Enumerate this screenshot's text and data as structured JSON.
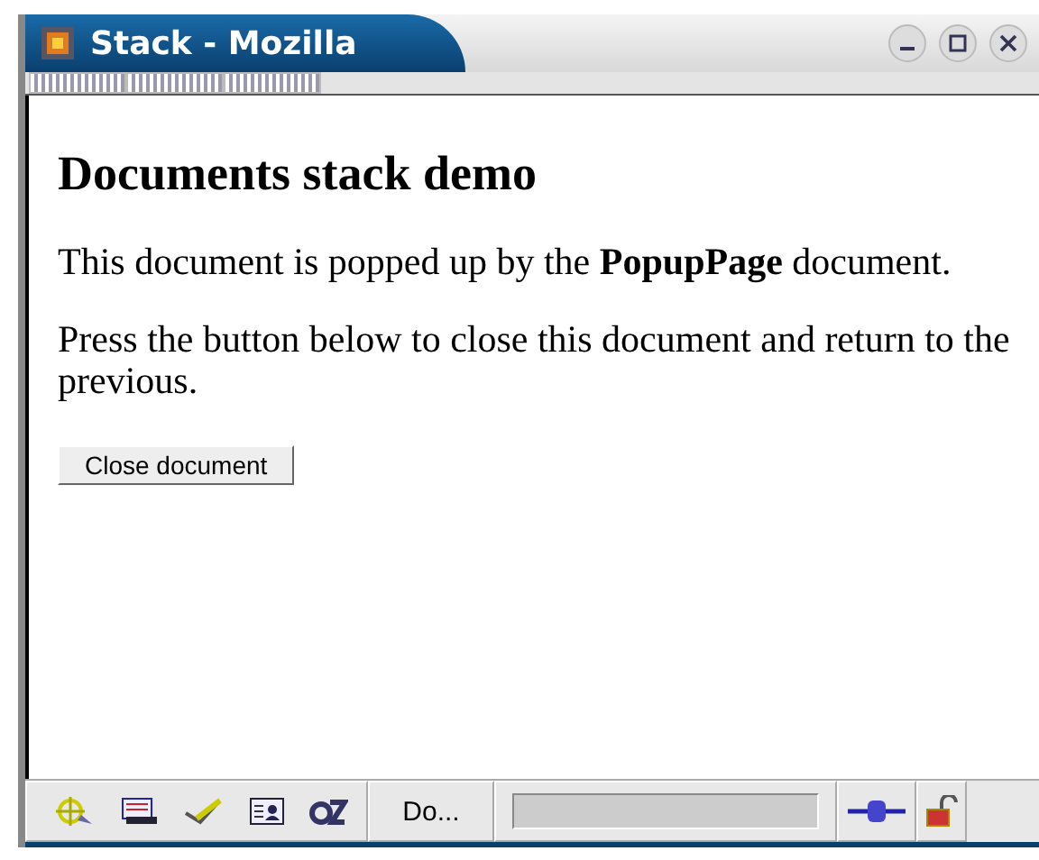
{
  "window": {
    "title": "Stack - Mozilla"
  },
  "page": {
    "heading": "Documents stack demo",
    "paragraphs": [
      "This document is popped up by the **PopupPage** document.",
      "Press the button below to close this document and return to the previous."
    ],
    "button": "Close document"
  },
  "status_bar": {
    "text": "Do..."
  }
}
